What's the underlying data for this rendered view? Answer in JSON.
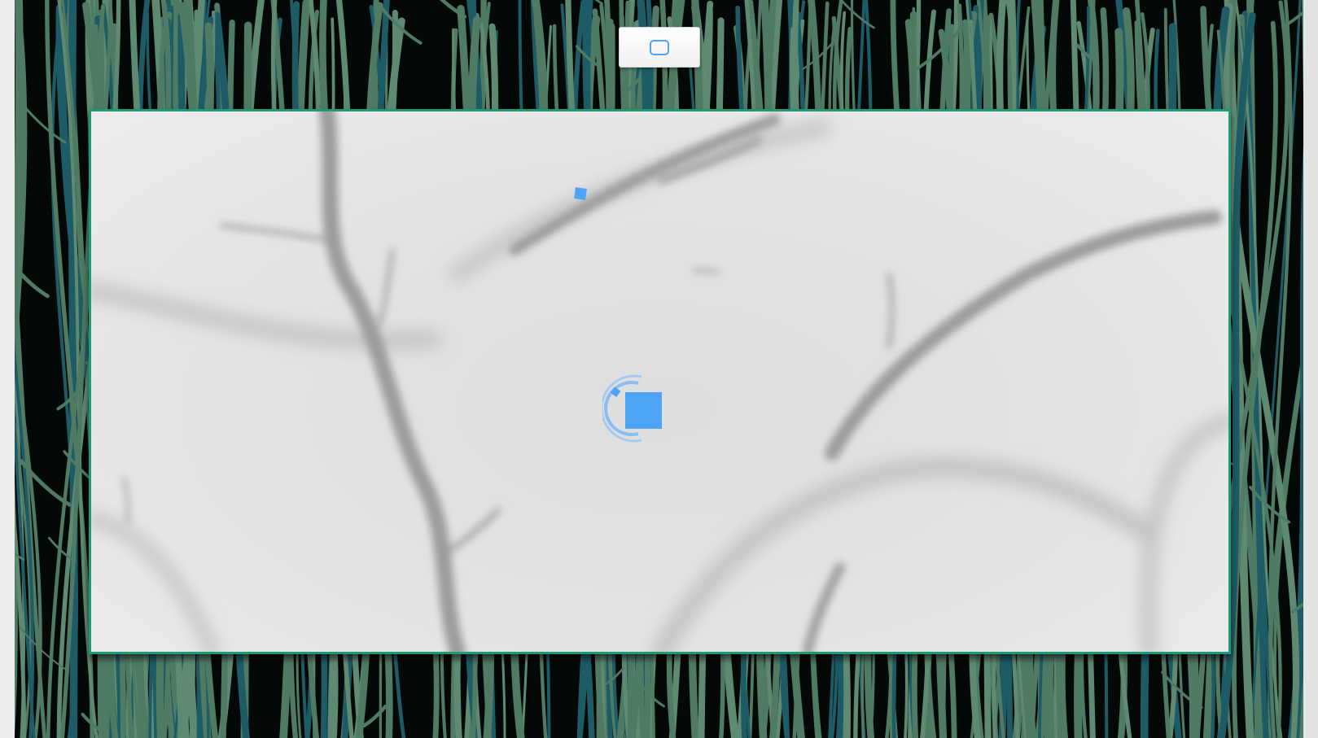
{
  "game": {
    "mode_button": {
      "icon": "square-outline-icon"
    },
    "player": {
      "icon": "blue-square-player"
    },
    "target": {
      "icon": "small-blue-square"
    }
  },
  "colors": {
    "accent": "#4da3f6",
    "frame": "#1f9a74",
    "grass": "#4f7a63",
    "grass_dark": "#1d5c66",
    "play_bg": "#e3e3e3"
  }
}
